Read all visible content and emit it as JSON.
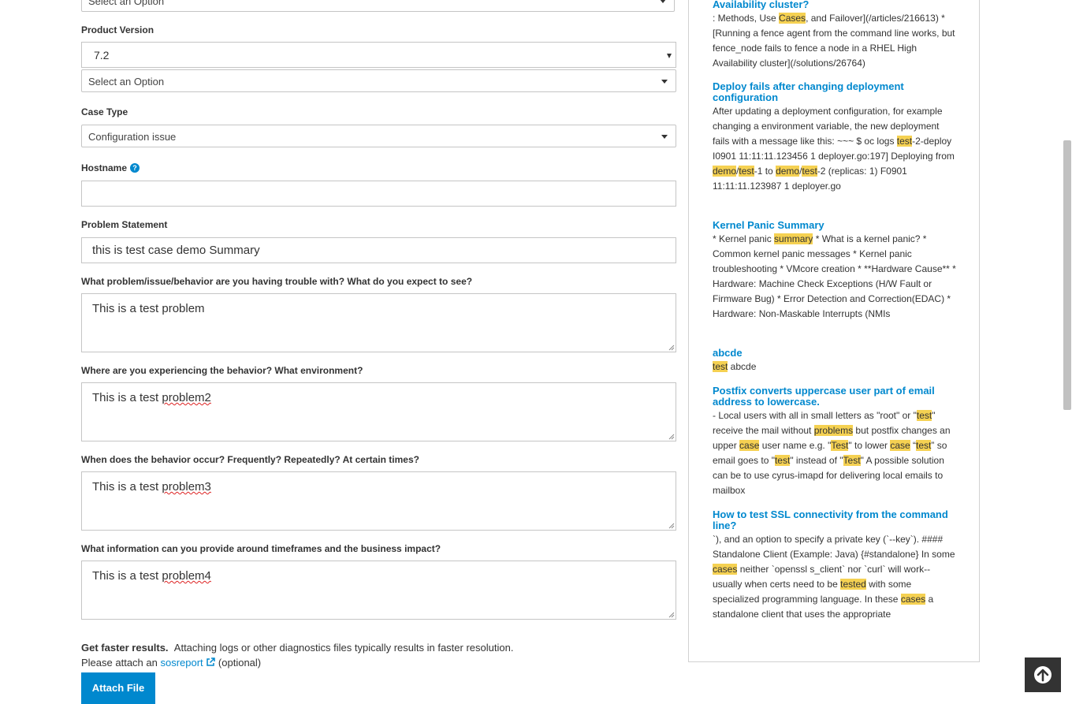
{
  "form": {
    "top_select": {
      "placeholder": "Select an Option"
    },
    "product_version": {
      "label": "Product Version",
      "value": "7.2",
      "sub_select": "Select an Option"
    },
    "case_type": {
      "label": "Case Type",
      "value": "Configuration issue"
    },
    "hostname": {
      "label": "Hostname",
      "help_icon": "?",
      "value": ""
    },
    "problem_statement": {
      "label": "Problem Statement",
      "value": "this is test case demo Summary"
    },
    "q1": {
      "label": "What problem/issue/behavior are you having trouble with?  What do you expect to see?",
      "value": "This is a test problem"
    },
    "q2": {
      "label": "Where are you experiencing the behavior?  What environment?",
      "value_prefix": "This is a test ",
      "value_flagged": "problem2"
    },
    "q3": {
      "label": "When does the behavior occur? Frequently?  Repeatedly?   At certain times?",
      "value_prefix": "This is a test ",
      "value_flagged": "problem3"
    },
    "q4": {
      "label": "What information can you provide around timeframes and the business impact?",
      "value_prefix": "This is a test ",
      "value_flagged": "problem4"
    },
    "attach": {
      "bold": "Get faster results.",
      "text": "Attaching logs or other diagnostics files typically results in faster resolution.",
      "line2_prefix": "Please attach an ",
      "link": "sosreport",
      "line2_suffix": "(optional)",
      "button": "Attach File"
    }
  },
  "results": [
    {
      "title": "Availability cluster?",
      "snippet": [
        ": Methods, Use ",
        {
          "hl": "Cases"
        },
        ", and Failover](/articles/216613) * [Running a fence agent from the command line works, but fence_node fails to fence a node in a RHEL High Availability cluster](/solutions/26764)"
      ]
    },
    {
      "title": "Deploy fails after changing deployment configuration",
      "snippet": [
        "After updating a deployment configuration, for example changing a environment variable, the new deployment fails with a message like this: ~~~ $ oc logs ",
        {
          "hl": "test"
        },
        "-2-deploy I0901 11:11:11.123456 1 deployer.go:197] Deploying from ",
        {
          "hl": "demo"
        },
        "/",
        {
          "hl": "test"
        },
        "-1 to ",
        {
          "hl": "demo"
        },
        "/",
        {
          "hl": "test"
        },
        "-2 (replicas: 1) F0901 11:11:11.123987 1 deployer.go"
      ]
    },
    {
      "title": "Kernel Panic Summary",
      "snippet": [
        "* Kernel panic ",
        {
          "hl": "summary"
        },
        " * What is a kernel panic? * Common kernel panic messages * Kernel panic troubleshooting * VMcore creation * **Hardware Cause** * Hardware: Machine Check Exceptions (H/W Fault or Firmware Bug) * Error Detection and Correction(EDAC) * Hardware: Non-Maskable Interrupts (NMIs"
      ]
    },
    {
      "title": "abcde",
      "snippet": [
        {
          "hl": "test"
        },
        " abcde"
      ]
    },
    {
      "title": "Postfix converts uppercase user part of email address to lowercase.",
      "snippet": [
        "- Local users with all in small letters as \"root\" or \"",
        {
          "hl": "test"
        },
        "\" receive the mail without ",
        {
          "hl": "problems"
        },
        " but postfix changes an upper ",
        {
          "hl": "case"
        },
        " user name e.g. \"",
        {
          "hl": "Test"
        },
        "\" to lower ",
        {
          "hl": "case"
        },
        " “",
        {
          "hl": "test"
        },
        "” so email goes to \"",
        {
          "hl": "test"
        },
        "\" instead of \"",
        {
          "hl": "Test"
        },
        "\" A possible solution can be to use cyrus-imapd for delivering local emails to mailbox"
      ]
    },
    {
      "title": "How to test SSL connectivity from the command line?",
      "snippet": [
        "`), and an option to specify a private key (`--key`). #### Standalone Client (Example: Java) {#standalone} In some ",
        {
          "hl": "cases"
        },
        " neither `openssl s_client` nor `curl` will work-- usually when certs need to be ",
        {
          "hl": "tested"
        },
        " with some specialized programming language. In these ",
        {
          "hl": "cases"
        },
        " a standalone client that uses the appropriate"
      ]
    }
  ],
  "icons": {
    "help": "question-circle-icon",
    "external": "external-link-icon",
    "back_to_top": "arrow-up-circle-icon"
  },
  "colors": {
    "accent": "#0088ce",
    "highlight": "#f5d152",
    "back_to_top_bg": "#333333"
  }
}
